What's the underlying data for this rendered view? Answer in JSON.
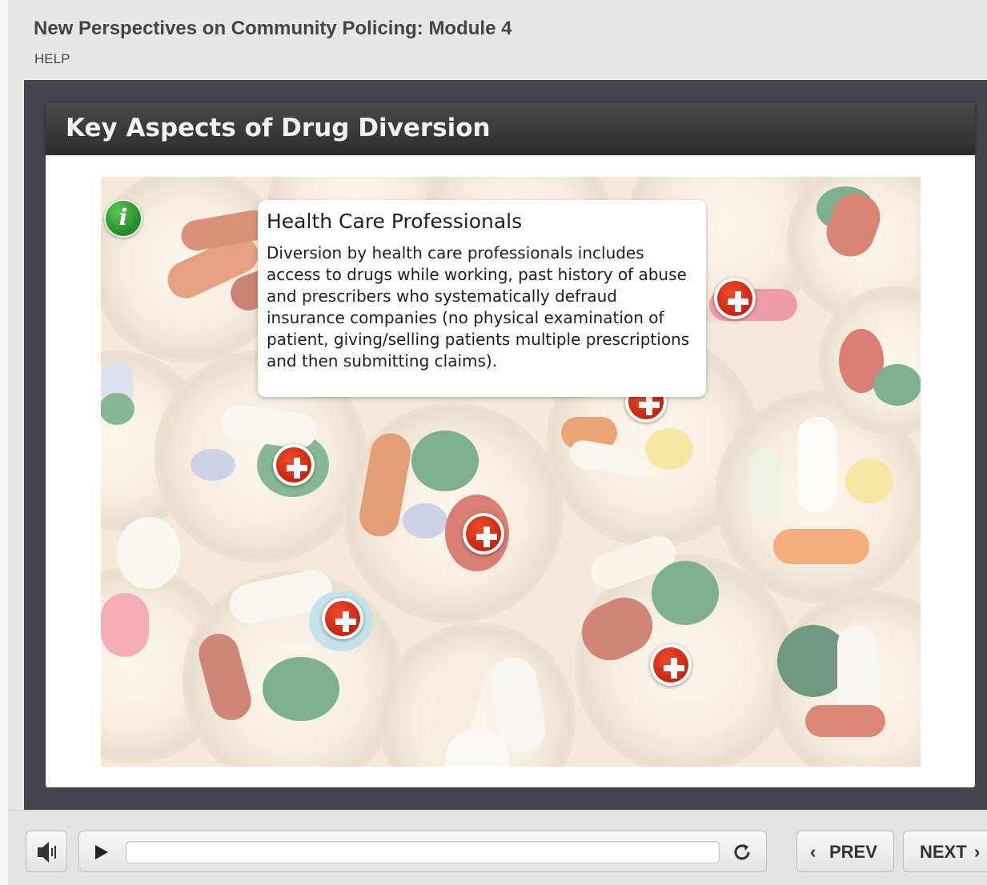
{
  "header": {
    "course_title": "New Perspectives on Community Policing: Module 4",
    "help_label": "HELP"
  },
  "slide": {
    "title": "Key Aspects of Drug Diversion",
    "info_icon_label": "i",
    "popup": {
      "title": "Health Care Professionals",
      "text": "Diversion by health care professionals includes access to drugs while working, past history of abuse and prescribers who systematically defraud insurance companies (no physical examination of patient, giving/selling patients multiple prescriptions and then submitting claims)."
    },
    "hotspots": [
      {
        "icon": "plus-icon"
      },
      {
        "icon": "plus-icon"
      },
      {
        "icon": "plus-icon"
      },
      {
        "icon": "plus-icon"
      },
      {
        "icon": "plus-icon"
      },
      {
        "icon": "plus-icon"
      }
    ]
  },
  "controls": {
    "volume_icon": "speaker-icon",
    "play_icon": "play-icon",
    "progress": 0,
    "replay_icon": "replay-icon",
    "prev_label": "PREV",
    "next_label": "NEXT",
    "prev_chevron": "‹",
    "next_chevron": "›"
  },
  "colors": {
    "hotspot_red": "#d3260f",
    "info_green": "#2a9a2e",
    "stage_dark": "#44454b",
    "title_bar": "#333333"
  }
}
